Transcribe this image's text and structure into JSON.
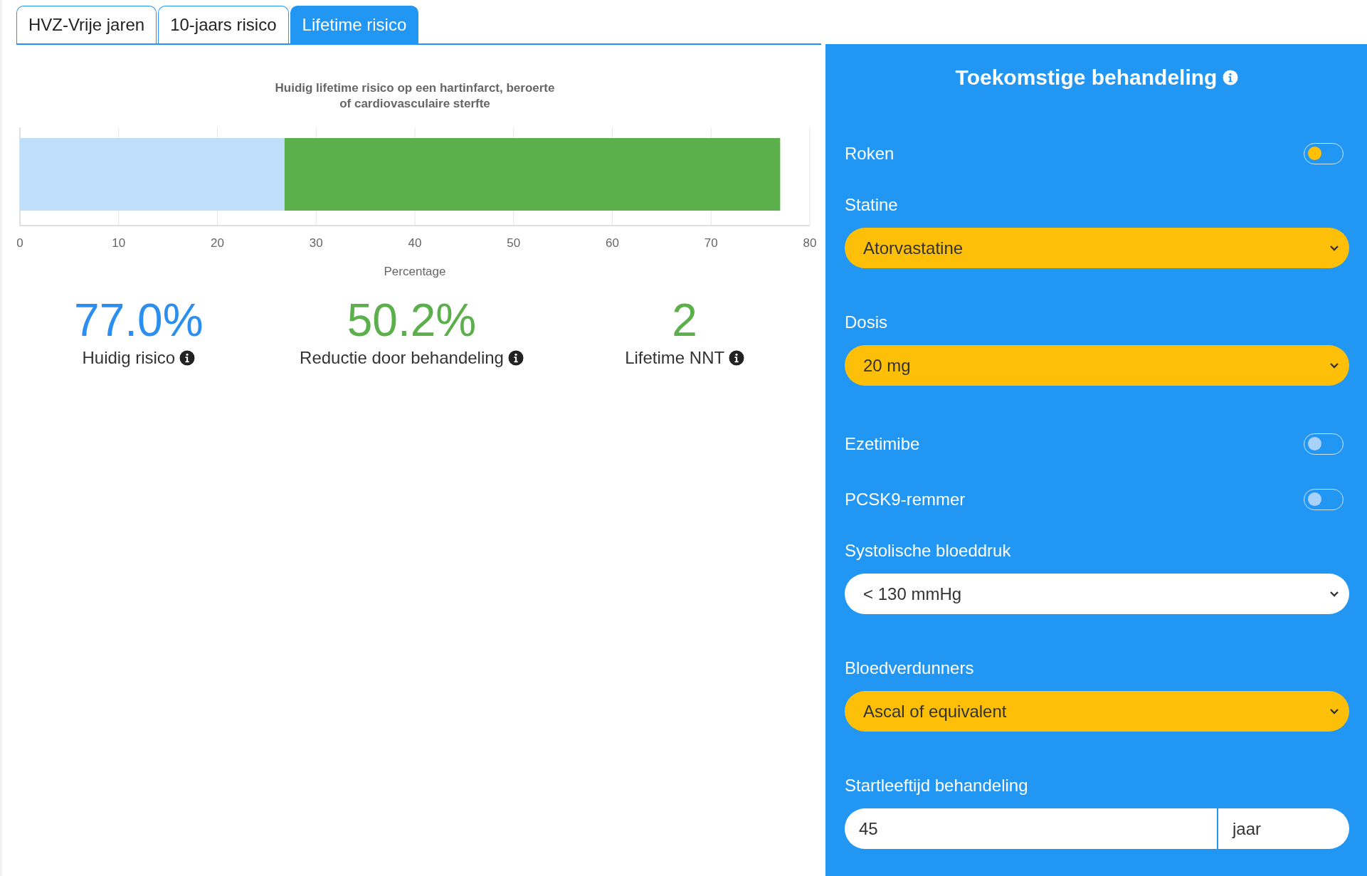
{
  "tabs": [
    {
      "label": "HVZ-Vrije jaren",
      "selected": false
    },
    {
      "label": "10-jaars risico",
      "selected": false
    },
    {
      "label": "Lifetime risico",
      "selected": true
    }
  ],
  "chart": {
    "chart_data": {
      "type": "bar",
      "orientation": "horizontal",
      "stacked": true,
      "title": "Huidig lifetime risico op een hartinfarct, beroerte of cardiovasculaire sterfte",
      "xlabel": "Percentage",
      "categories": [
        null
      ],
      "grid": true,
      "xlim": [
        0,
        80
      ],
      "xticks": [
        0,
        10,
        20,
        30,
        40,
        50,
        60,
        70,
        80
      ],
      "series": [
        {
          "color": "#bfdef9",
          "values": [
            26.8
          ]
        },
        {
          "color": "#5bb04c",
          "values": [
            50.2
          ]
        }
      ]
    }
  },
  "metrics": [
    {
      "value": "77.0%",
      "label": "Huidig risico",
      "color": "#2a8ff0"
    },
    {
      "value": "50.2%",
      "label": "Reductie door behandeling",
      "color": "#5bb04c"
    },
    {
      "value": "2",
      "label": "Lifetime NNT",
      "color": "#5bb04c"
    }
  ],
  "panel": {
    "title": "Toekomstige behandeling",
    "fields": [
      {
        "kind": "toggle",
        "label": "Roken",
        "on": false,
        "color": "#fdbf08"
      },
      {
        "kind": "select",
        "label": "Statine",
        "value": "Atorvastatine",
        "highlighted": true
      },
      {
        "kind": "select",
        "label": "Dosis",
        "value": "20 mg",
        "highlighted": true
      },
      {
        "kind": "toggle",
        "label": "Ezetimibe",
        "on": false,
        "color": "#a9d2fa"
      },
      {
        "kind": "toggle",
        "label": "PCSK9-remmer",
        "on": false,
        "color": "#a9d2fa"
      },
      {
        "kind": "select",
        "label": "Systolische bloeddruk",
        "value": "< 130 mmHg",
        "highlighted": false
      },
      {
        "kind": "select",
        "label": "Bloedverdunners",
        "value": "Ascal of equivalent",
        "highlighted": true
      },
      {
        "kind": "input",
        "label": "Startleeftijd behandeling",
        "value": "45",
        "unit": "jaar"
      }
    ]
  }
}
